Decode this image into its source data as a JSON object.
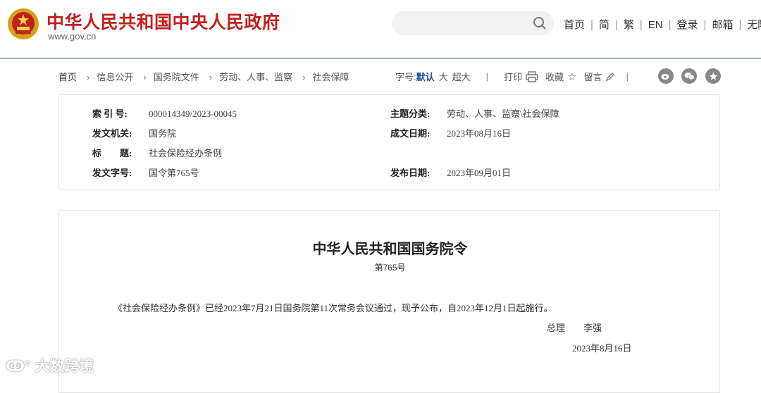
{
  "header": {
    "site_title": "中华人民共和国中央人民政府",
    "site_url": "www.gov.cn",
    "search_placeholder": "",
    "nav": [
      "首页",
      "简",
      "繁",
      "EN",
      "登录",
      "邮箱",
      "无障"
    ]
  },
  "breadcrumb": [
    "首页",
    "信息公开",
    "国务院文件",
    "劳动、人事、监察",
    "社会保障"
  ],
  "toolbar": {
    "font_label": "字号:",
    "font_default": "默认",
    "font_large": "大",
    "font_xlarge": "超大",
    "print": "打印",
    "favorite": "收藏",
    "comment": "留言"
  },
  "meta": {
    "index_label": "索 引 号:",
    "index_value": "000014349/2023-00045",
    "topic_label": "主题分类:",
    "topic_value": "劳动、人事、监察\\社会保障",
    "issuer_label": "发文机关:",
    "issuer_value": "国务院",
    "written_label": "成文日期:",
    "written_value": "2023年08月16日",
    "title_label": "标　　题:",
    "title_value": "社会保险经办条例",
    "docno_label": "发文字号:",
    "docno_value": "国令第765号",
    "published_label": "发布日期:",
    "published_value": "2023年09月01日"
  },
  "document": {
    "heading": "中华人民共和国国务院令",
    "number": "第765号",
    "paragraph": "《社会保险经办条例》已经2023年7月21日国务院第11次常务会议通过，现予公布，自2023年12月1日起施行。",
    "signer_title": "总理",
    "signer_name": "李强",
    "date": "2023年8月16日"
  },
  "watermark": "大数跨境",
  "colors": {
    "brand_red": "#c0201e",
    "rule_blue": "#2b5d8f",
    "active_blue": "#1a4e9a"
  }
}
